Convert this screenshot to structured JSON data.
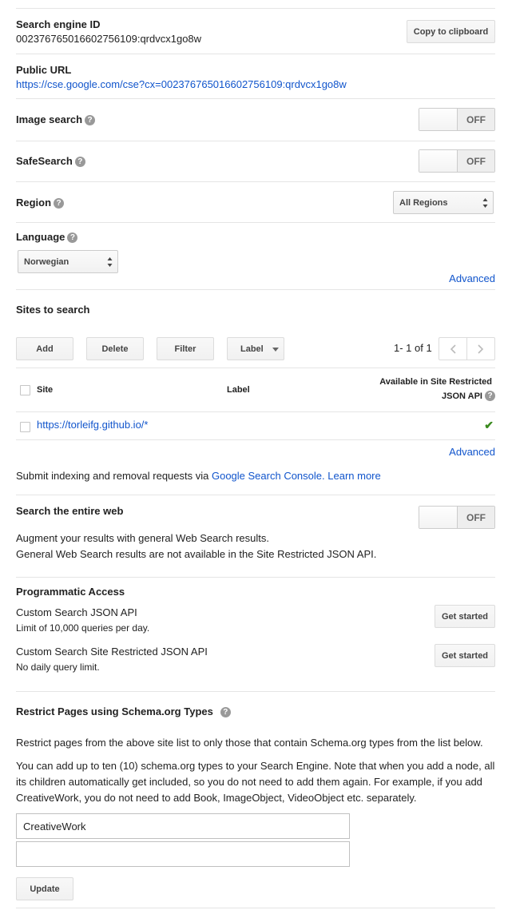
{
  "engine": {
    "id_label": "Search engine ID",
    "id_value": "002376765016602756109:qrdvcx1go8w",
    "copy_button": "Copy to clipboard",
    "public_url_label": "Public URL",
    "public_url_value": "https://cse.google.com/cse?cx=002376765016602756109:qrdvcx1go8w"
  },
  "settings": {
    "image_search_label": "Image search",
    "image_search_state": "OFF",
    "safesearch_label": "SafeSearch",
    "safesearch_state": "OFF",
    "region_label": "Region",
    "region_value": "All Regions",
    "language_label": "Language",
    "language_value": "Norwegian",
    "advanced_link": "Advanced",
    "help_glyph": "?"
  },
  "sites": {
    "title": "Sites to search",
    "buttons": {
      "add": "Add",
      "delete": "Delete",
      "filter": "Filter",
      "label": "Label"
    },
    "pagination": "1- 1 of 1",
    "columns": {
      "site": "Site",
      "label": "Label",
      "available_line1": "Available in Site Restricted",
      "available_line2": "JSON API"
    },
    "rows": [
      {
        "site": "https://torleifg.github.io/*",
        "label": "",
        "available": "✔"
      }
    ],
    "advanced_link": "Advanced",
    "submit_text": "Submit indexing and removal requests via",
    "console_link": "Google Search Console.",
    "learn_more": "Learn more"
  },
  "entire_web": {
    "title": "Search the entire web",
    "state": "OFF",
    "line1": "Augment your results with general Web Search results.",
    "line2": "General Web Search results are not available in the Site Restricted JSON API."
  },
  "programmatic": {
    "title": "Programmatic Access",
    "api1_name": "Custom Search JSON API",
    "api1_desc": "Limit of 10,000 queries per day.",
    "api1_button": "Get started",
    "api2_name": "Custom Search Site Restricted JSON API",
    "api2_desc": "No daily query limit.",
    "api2_button": "Get started"
  },
  "schema": {
    "title": "Restrict Pages using Schema.org Types",
    "para1": "Restrict pages from the above site list to only those that contain Schema.org types from the list below.",
    "para2": "You can add up to ten (10) schema.org types to your Search Engine. Note that when you add a node, all its children automatically get included, so you do not need to add them again. For example, if you add CreativeWork, you do not need to add Book, ImageObject, VideoObject etc. separately.",
    "input1_value": "CreativeWork",
    "input2_value": "",
    "update_button": "Update"
  }
}
